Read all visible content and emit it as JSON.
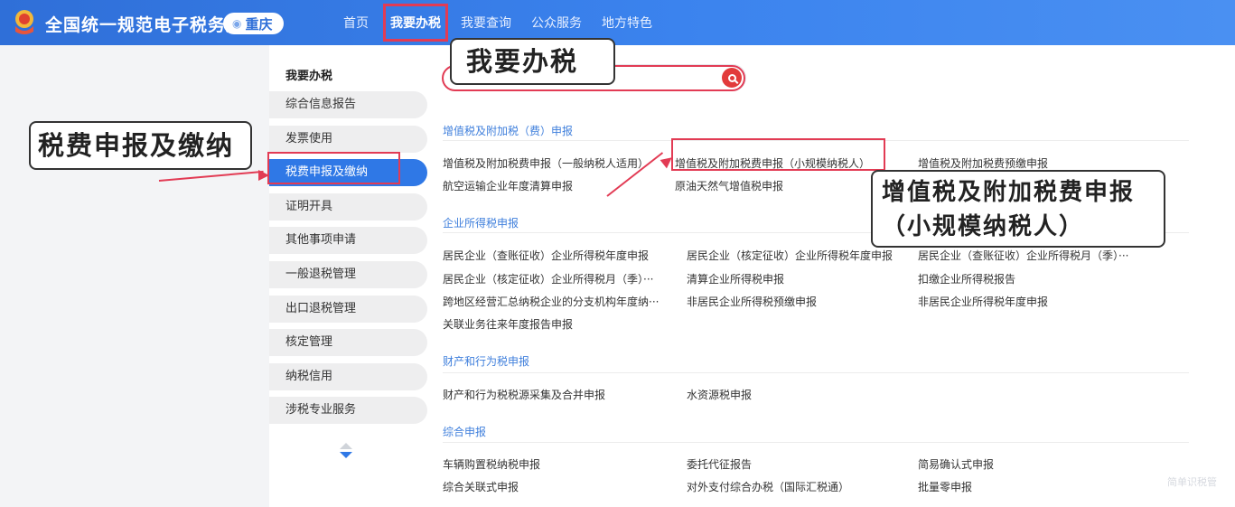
{
  "header": {
    "site_title": "全国统一规范电子税务局",
    "region": "重庆",
    "nav": [
      "首页",
      "我要办税",
      "我要查询",
      "公众服务",
      "地方特色"
    ],
    "active_nav_index": 1
  },
  "sidebar": {
    "title": "我要办税",
    "items": [
      "综合信息报告",
      "发票使用",
      "税费申报及缴纳",
      "证明开具",
      "其他事项申请",
      "一般退税管理",
      "出口退税管理",
      "核定管理",
      "纳税信用",
      "涉税专业服务"
    ],
    "active_index": 2
  },
  "search": {
    "placeholder": ""
  },
  "sections": [
    {
      "title": "增值税及附加税（费）申报",
      "rows": [
        [
          "增值税及附加税费申报（一般纳税人适用）",
          "增值税及附加税费申报（小规模纳税人）",
          "增值税及附加税费预缴申报"
        ],
        [
          "航空运输企业年度清算申报",
          "原油天然气增值税申报",
          ""
        ]
      ]
    },
    {
      "title": "企业所得税申报",
      "rows": [
        [
          "居民企业（查账征收）企业所得税年度申报",
          "居民企业（核定征收）企业所得税年度申报",
          "居民企业（查账征收）企业所得税月（季）···"
        ],
        [
          "居民企业（核定征收）企业所得税月（季）···",
          "清算企业所得税申报",
          "扣缴企业所得税报告"
        ],
        [
          "跨地区经营汇总纳税企业的分支机构年度纳···",
          "非居民企业所得税预缴申报",
          "非居民企业所得税年度申报"
        ],
        [
          "关联业务往来年度报告申报",
          "",
          ""
        ]
      ]
    },
    {
      "title": "财产和行为税申报",
      "rows": [
        [
          "财产和行为税税源采集及合并申报",
          "水资源税申报",
          ""
        ]
      ]
    },
    {
      "title": "综合申报",
      "rows": [
        [
          "车辆购置税纳税申报",
          "委托代征报告",
          "简易确认式申报"
        ],
        [
          "综合关联式申报",
          "对外支付综合办税（国际汇税通）",
          "批量零申报"
        ]
      ]
    }
  ],
  "annotations": {
    "top": "我要办税",
    "left": "税费申报及缴纳",
    "right": "增值税及附加税费申报（小规模纳税人）"
  },
  "watermark": "简单识税管",
  "colors": {
    "header_blue": "#3b83ee",
    "accent_blue": "#2f78e6",
    "highlight_red": "#e23b54"
  }
}
